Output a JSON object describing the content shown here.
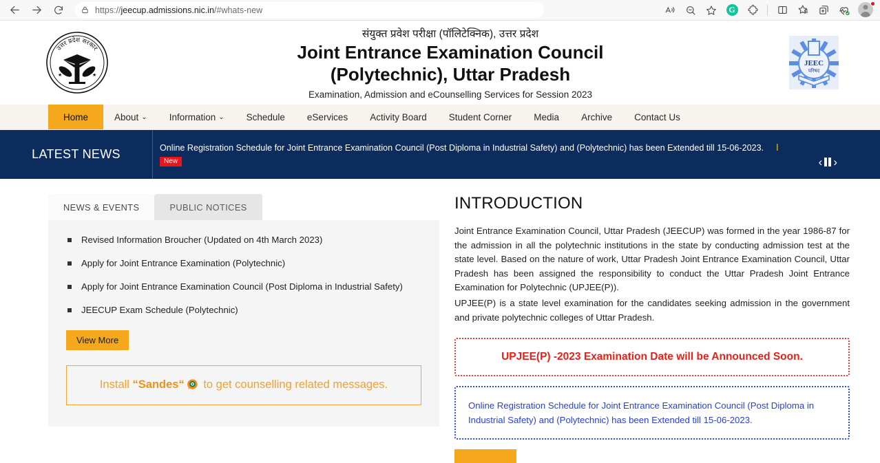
{
  "browser": {
    "url_secure_prefix": "https://",
    "url_main": "jeecup.admissions.nic.in",
    "url_fragment": "/#whats-new",
    "icons": {
      "back": "back-arrow-icon",
      "forward": "forward-arrow-icon",
      "refresh": "refresh-icon",
      "lock": "lock-icon",
      "read_aloud": "read-aloud-icon",
      "zoom_out": "zoom-out-icon",
      "favorite": "star-favorite-icon",
      "grammarly": "G",
      "extensions": "extensions-puzzle-icon",
      "split_screen": "split-screen-icon",
      "collections": "collections-icon",
      "add_tab": "add-tab-icon",
      "performance": "performance-heart-icon",
      "profile": "profile-avatar-icon"
    }
  },
  "header": {
    "hindi_title": "संयुक्त प्रवेश परीक्षा (पॉलिटेक्निक), उत्तर प्रदेश",
    "title_line1": "Joint Entrance Examination Council",
    "title_line2": "(Polytechnic), Uttar Pradesh",
    "subtitle": "Examination, Admission and eCounselling Services for Session 2023",
    "emblem_name": "up-government-emblem",
    "logo_name": "jeec-logo",
    "logo_text": "JEEC"
  },
  "nav": {
    "items": [
      {
        "label": "Home",
        "active": true,
        "caret": false
      },
      {
        "label": "About",
        "active": false,
        "caret": true
      },
      {
        "label": "Information",
        "active": false,
        "caret": true
      },
      {
        "label": "Schedule",
        "active": false,
        "caret": false
      },
      {
        "label": "eServices",
        "active": false,
        "caret": false
      },
      {
        "label": "Activity Board",
        "active": false,
        "caret": false
      },
      {
        "label": "Student Corner",
        "active": false,
        "caret": false
      },
      {
        "label": "Media",
        "active": false,
        "caret": false
      },
      {
        "label": "Archive",
        "active": false,
        "caret": false
      },
      {
        "label": "Contact Us",
        "active": false,
        "caret": false
      }
    ]
  },
  "ticker": {
    "label": "LATEST NEWS",
    "text": "Online Registration Schedule for Joint Entrance Examination Council (Post Diploma in Industrial Safety) and (Polytechnic) has been Extended till 15-06-2023.",
    "badge": "New",
    "tail_glyph": "ا",
    "prev": "‹",
    "next": "›",
    "pause_name": "pause-icon"
  },
  "left": {
    "tabs": [
      {
        "label": "NEWS & EVENTS",
        "active": true
      },
      {
        "label": "PUBLIC NOTICES",
        "active": false
      }
    ],
    "news_items": [
      "Revised Information Broucher (Updated on 4th March 2023)",
      "Apply for Joint Entrance Examination (Polytechnic)",
      "Apply for Joint Entrance Examination Council (Post Diploma in Industrial Safety)",
      "JEECUP Exam Schedule (Polytechnic)"
    ],
    "view_more": "View More",
    "sandes": {
      "prefix": "Install ",
      "quote_open": "“",
      "brand": "Sandes",
      "quote_close": "“",
      "suffix": " to get counselling related messages.",
      "icon_name": "sandes-app-icon"
    }
  },
  "right": {
    "intro_title": "INTRODUCTION",
    "paragraph1": "Joint Entrance Examination Council, Uttar Pradesh (JEECUP) was formed in the year 1986-87 for the admission in all the polytechnic institutions in the state by conducting admission test at the state level. Based on the nature of work, Uttar Pradesh Joint Entrance Examination Council, Uttar Pradesh has been assigned the responsibility to conduct the Uttar Pradesh Joint Entrance Examination for Polytechnic (UPJEE(P)).",
    "paragraph2": "UPJEE(P) is a state level examination for the candidates seeking admission in the government and private polytechnic colleges of Uttar Pradesh.",
    "notice_red": "UPJEE(P) -2023 Examination Date will be Announced Soon.",
    "notice_blue": "Online Registration Schedule for Joint Entrance Examination Council (Post Diploma in Industrial Safety) and (Polytechnic) has been Extended till 15-06-2023."
  },
  "colors": {
    "accent_orange": "#f5a81c",
    "navy": "#0d2c5e",
    "red": "#e8201a",
    "blue": "#2b42cf",
    "nav_bg": "#f7f4ef"
  }
}
